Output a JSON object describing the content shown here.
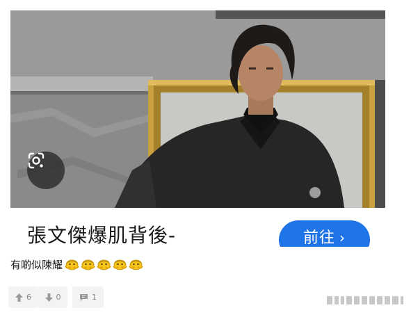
{
  "ad": {
    "title": "張文傑爆肌背後-",
    "cta_label": "前往",
    "cta_chevron": "›",
    "image_subject": "man in dark suit standing before an ornate gold-framed mirror",
    "lens_icon": "google-lens-icon",
    "colors": {
      "cta": "#1f74e8",
      "frame": "#c9a040"
    }
  },
  "post": {
    "text": "有啲似陳耀",
    "emoji": "peeking-face-emoji",
    "emoji_count": 5
  },
  "actions": [
    {
      "name": "upvote",
      "icon": "thumbs-up-icon",
      "count": "6"
    },
    {
      "name": "downvote",
      "icon": "thumbs-down-icon",
      "count": "0"
    },
    {
      "name": "comment",
      "icon": "comment-bubble-icon",
      "count": "1"
    }
  ]
}
